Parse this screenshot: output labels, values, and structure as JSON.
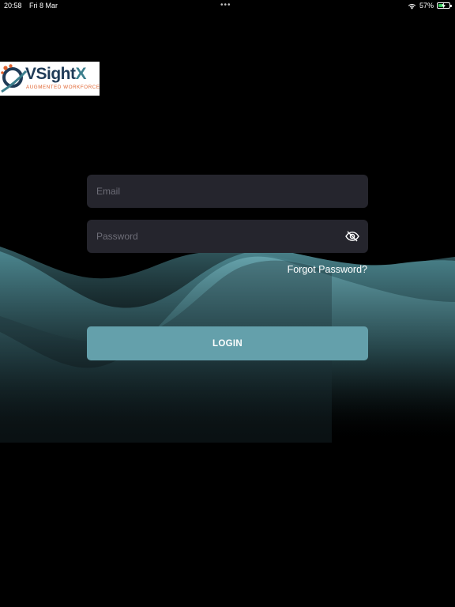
{
  "status_bar": {
    "time": "20:58",
    "date": "Fri 8 Mar",
    "dots": "•••",
    "battery_percent": "57%",
    "battery_level": 0.57,
    "wifi_icon": "wifi-icon",
    "battery_icon": "battery-charging-icon"
  },
  "logo": {
    "word_part1": "VSight",
    "word_part2": "X",
    "tagline": "AUGMENTED WORKFORCE"
  },
  "form": {
    "email": {
      "placeholder": "Email",
      "value": ""
    },
    "password": {
      "placeholder": "Password",
      "value": "",
      "toggle_icon": "eye-slash-icon"
    },
    "forgot_label": "Forgot Password?",
    "login_label": "LOGIN"
  },
  "colors": {
    "background": "#000000",
    "input_background": "#25252d",
    "accent": "#64a0ab",
    "wave": "#5a9aa4"
  }
}
